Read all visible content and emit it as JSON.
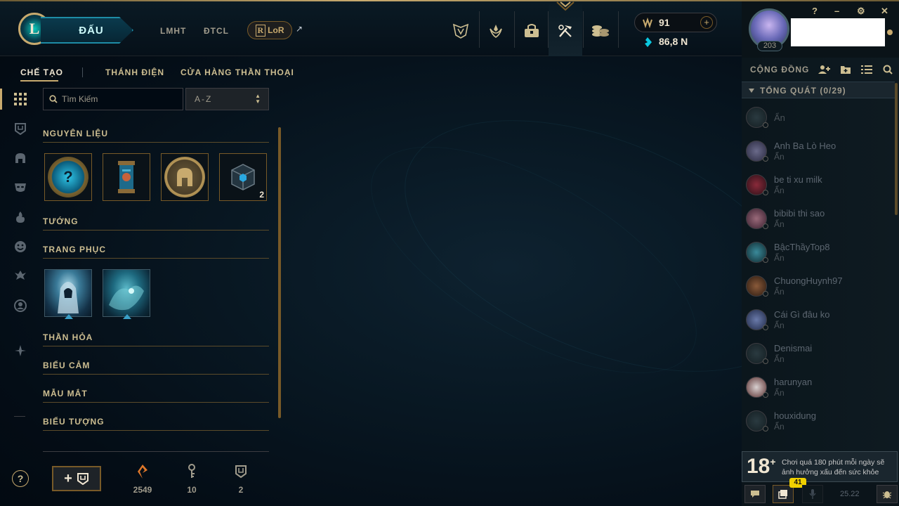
{
  "topbar": {
    "logo_letter": "L",
    "play_label": "ĐẤU",
    "nav": [
      "LMHT",
      "ĐTCL"
    ],
    "lor_label": "LoR",
    "lor_ext": "↗",
    "tools": [
      "worlds-icon",
      "ranked-icon",
      "collection-icon",
      "crafting-icon",
      "store-icon"
    ],
    "rp_value": "91",
    "be_value": "86,8 N",
    "plus": "+"
  },
  "profile": {
    "level": "203"
  },
  "window": {
    "help": "?",
    "minimize": "–",
    "settings": "⚙",
    "close": "✕"
  },
  "subnav": {
    "tabs": [
      "CHẾ TẠO",
      "THÁNH ĐIỆN",
      "CỬA HÀNG THẦN THOẠI"
    ]
  },
  "leftnav": [
    "grid-icon",
    "chest-icon",
    "helmet-icon",
    "mask-icon",
    "flame-icon",
    "emote-icon",
    "ward-icon",
    "icon-icon",
    "extra-icon"
  ],
  "search": {
    "placeholder": "Tìm Kiếm"
  },
  "sort": {
    "value": "A-Z"
  },
  "sections": {
    "materials": "NGUYÊN LIỆU",
    "champions": "TƯỚNG",
    "skins": "TRANG PHỤC",
    "wards": "THẦN HỎA",
    "emotes": "BIỂU CẢM",
    "eyes": "MẪU MẮT",
    "icons": "BIỂU TƯỢNG"
  },
  "materials": [
    {
      "name": "mystery-orb",
      "count": ""
    },
    {
      "name": "capsule",
      "count": ""
    },
    {
      "name": "helmet-token",
      "count": ""
    },
    {
      "name": "chest",
      "count": "2"
    }
  ],
  "footer": {
    "help": "?",
    "add_label": "+",
    "orange_essence": "2549",
    "keys": "10",
    "chests": "2"
  },
  "social": {
    "title": "CỘNG ĐỒNG",
    "group": "TỔNG QUÁT (0/29)",
    "friends": [
      {
        "name": "Ẩn",
        "status": ""
      },
      {
        "name": "Anh Ba Lò Heo",
        "status": "Ẩn"
      },
      {
        "name": "be ti xu milk",
        "status": "Ẩn"
      },
      {
        "name": "bibibi thi sao",
        "status": "Ẩn"
      },
      {
        "name": "BậcThầyTop8",
        "status": "Ẩn"
      },
      {
        "name": "ChuongHuynh97",
        "status": "Ẩn"
      },
      {
        "name": "Cái Gì đâu ko",
        "status": "Ẩn"
      },
      {
        "name": "Denismai",
        "status": "Ẩn"
      },
      {
        "name": "harunyan",
        "status": "Ẩn"
      },
      {
        "name": "houxidung",
        "status": "Ẩn"
      }
    ],
    "notice_age": "18",
    "notice_plus": "+",
    "notice_text": "Chơi quá 180 phút mỗi ngày sẽ ảnh hưởng xấu đến sức khỏe",
    "badge": "41",
    "clock": "25.22"
  },
  "colors": {
    "gold": "#c8aa6e",
    "teal": "#0ac8b9",
    "bg": "#010a13"
  }
}
